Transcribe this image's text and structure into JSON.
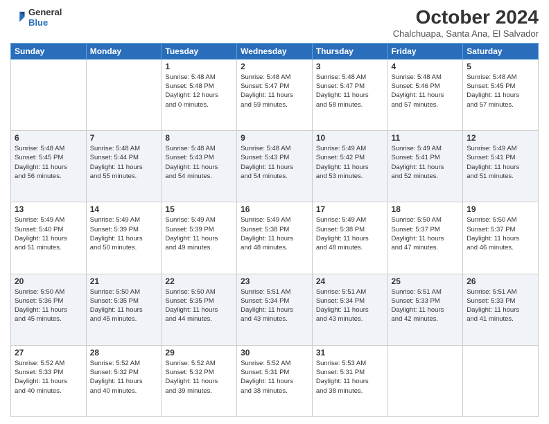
{
  "header": {
    "logo_line1": "General",
    "logo_line2": "Blue",
    "month_title": "October 2024",
    "location": "Chalchuapa, Santa Ana, El Salvador"
  },
  "days_of_week": [
    "Sunday",
    "Monday",
    "Tuesday",
    "Wednesday",
    "Thursday",
    "Friday",
    "Saturday"
  ],
  "weeks": [
    [
      {
        "day": "",
        "text": ""
      },
      {
        "day": "",
        "text": ""
      },
      {
        "day": "1",
        "text": "Sunrise: 5:48 AM\nSunset: 5:48 PM\nDaylight: 12 hours\nand 0 minutes."
      },
      {
        "day": "2",
        "text": "Sunrise: 5:48 AM\nSunset: 5:47 PM\nDaylight: 11 hours\nand 59 minutes."
      },
      {
        "day": "3",
        "text": "Sunrise: 5:48 AM\nSunset: 5:47 PM\nDaylight: 11 hours\nand 58 minutes."
      },
      {
        "day": "4",
        "text": "Sunrise: 5:48 AM\nSunset: 5:46 PM\nDaylight: 11 hours\nand 57 minutes."
      },
      {
        "day": "5",
        "text": "Sunrise: 5:48 AM\nSunset: 5:45 PM\nDaylight: 11 hours\nand 57 minutes."
      }
    ],
    [
      {
        "day": "6",
        "text": "Sunrise: 5:48 AM\nSunset: 5:45 PM\nDaylight: 11 hours\nand 56 minutes."
      },
      {
        "day": "7",
        "text": "Sunrise: 5:48 AM\nSunset: 5:44 PM\nDaylight: 11 hours\nand 55 minutes."
      },
      {
        "day": "8",
        "text": "Sunrise: 5:48 AM\nSunset: 5:43 PM\nDaylight: 11 hours\nand 54 minutes."
      },
      {
        "day": "9",
        "text": "Sunrise: 5:48 AM\nSunset: 5:43 PM\nDaylight: 11 hours\nand 54 minutes."
      },
      {
        "day": "10",
        "text": "Sunrise: 5:49 AM\nSunset: 5:42 PM\nDaylight: 11 hours\nand 53 minutes."
      },
      {
        "day": "11",
        "text": "Sunrise: 5:49 AM\nSunset: 5:41 PM\nDaylight: 11 hours\nand 52 minutes."
      },
      {
        "day": "12",
        "text": "Sunrise: 5:49 AM\nSunset: 5:41 PM\nDaylight: 11 hours\nand 51 minutes."
      }
    ],
    [
      {
        "day": "13",
        "text": "Sunrise: 5:49 AM\nSunset: 5:40 PM\nDaylight: 11 hours\nand 51 minutes."
      },
      {
        "day": "14",
        "text": "Sunrise: 5:49 AM\nSunset: 5:39 PM\nDaylight: 11 hours\nand 50 minutes."
      },
      {
        "day": "15",
        "text": "Sunrise: 5:49 AM\nSunset: 5:39 PM\nDaylight: 11 hours\nand 49 minutes."
      },
      {
        "day": "16",
        "text": "Sunrise: 5:49 AM\nSunset: 5:38 PM\nDaylight: 11 hours\nand 48 minutes."
      },
      {
        "day": "17",
        "text": "Sunrise: 5:49 AM\nSunset: 5:38 PM\nDaylight: 11 hours\nand 48 minutes."
      },
      {
        "day": "18",
        "text": "Sunrise: 5:50 AM\nSunset: 5:37 PM\nDaylight: 11 hours\nand 47 minutes."
      },
      {
        "day": "19",
        "text": "Sunrise: 5:50 AM\nSunset: 5:37 PM\nDaylight: 11 hours\nand 46 minutes."
      }
    ],
    [
      {
        "day": "20",
        "text": "Sunrise: 5:50 AM\nSunset: 5:36 PM\nDaylight: 11 hours\nand 45 minutes."
      },
      {
        "day": "21",
        "text": "Sunrise: 5:50 AM\nSunset: 5:35 PM\nDaylight: 11 hours\nand 45 minutes."
      },
      {
        "day": "22",
        "text": "Sunrise: 5:50 AM\nSunset: 5:35 PM\nDaylight: 11 hours\nand 44 minutes."
      },
      {
        "day": "23",
        "text": "Sunrise: 5:51 AM\nSunset: 5:34 PM\nDaylight: 11 hours\nand 43 minutes."
      },
      {
        "day": "24",
        "text": "Sunrise: 5:51 AM\nSunset: 5:34 PM\nDaylight: 11 hours\nand 43 minutes."
      },
      {
        "day": "25",
        "text": "Sunrise: 5:51 AM\nSunset: 5:33 PM\nDaylight: 11 hours\nand 42 minutes."
      },
      {
        "day": "26",
        "text": "Sunrise: 5:51 AM\nSunset: 5:33 PM\nDaylight: 11 hours\nand 41 minutes."
      }
    ],
    [
      {
        "day": "27",
        "text": "Sunrise: 5:52 AM\nSunset: 5:33 PM\nDaylight: 11 hours\nand 40 minutes."
      },
      {
        "day": "28",
        "text": "Sunrise: 5:52 AM\nSunset: 5:32 PM\nDaylight: 11 hours\nand 40 minutes."
      },
      {
        "day": "29",
        "text": "Sunrise: 5:52 AM\nSunset: 5:32 PM\nDaylight: 11 hours\nand 39 minutes."
      },
      {
        "day": "30",
        "text": "Sunrise: 5:52 AM\nSunset: 5:31 PM\nDaylight: 11 hours\nand 38 minutes."
      },
      {
        "day": "31",
        "text": "Sunrise: 5:53 AM\nSunset: 5:31 PM\nDaylight: 11 hours\nand 38 minutes."
      },
      {
        "day": "",
        "text": ""
      },
      {
        "day": "",
        "text": ""
      }
    ]
  ]
}
